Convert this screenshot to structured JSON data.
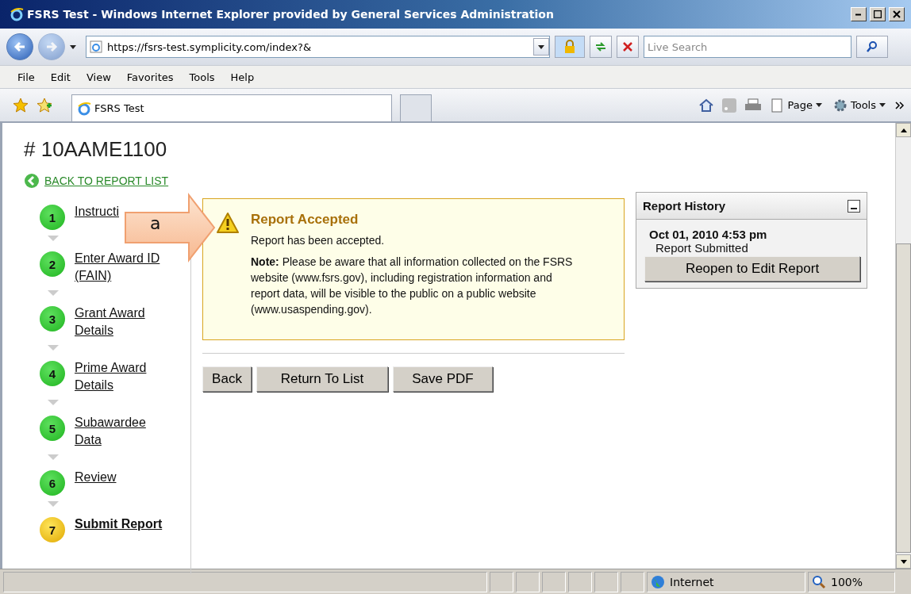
{
  "window": {
    "title": "FSRS Test - Windows Internet Explorer provided by General Services Administration"
  },
  "address_bar": {
    "url": "https://fsrs-test.symplicity.com/index?&",
    "search_placeholder": "Live Search"
  },
  "menu": [
    "File",
    "Edit",
    "View",
    "Favorites",
    "Tools",
    "Help"
  ],
  "tabs": [
    {
      "label": "FSRS Test",
      "selected": true
    }
  ],
  "command_bar": [
    "Page",
    "Tools"
  ],
  "page": {
    "title": "# 10AAME1100",
    "back_link": "BACK TO REPORT LIST",
    "steps": [
      {
        "number": "1",
        "label": "Instructi",
        "selected": false
      },
      {
        "number": "2",
        "label": "Enter Award ID (FAIN)",
        "selected": false
      },
      {
        "number": "3",
        "label": "Grant Award Details",
        "selected": false
      },
      {
        "number": "4",
        "label": "Prime Award Details",
        "selected": false
      },
      {
        "number": "5",
        "label": "Subawardee Data",
        "selected": false
      },
      {
        "number": "6",
        "label": "Review",
        "selected": false
      },
      {
        "number": "7",
        "label": "Submit Report",
        "selected": true
      }
    ],
    "alert": {
      "title": "Report Accepted",
      "message": "Report has been accepted.",
      "note": "**Note:** Please be aware that all information collected on the FSRS website (www.fsrs.gov), including registration information and report data, will be visible to the public on a public website (www.usaspending.gov)."
    },
    "buttons": [
      "Back",
      "Return To List",
      "Save PDF"
    ],
    "history": {
      "title": "Report History",
      "date": "Oct 01, 2010 4:53 pm",
      "event": "Report Submitted",
      "button": "Reopen to Edit Report"
    }
  },
  "callout": {
    "label": "a"
  },
  "status_bar": {
    "zone": "Internet",
    "zoom": "100%"
  }
}
